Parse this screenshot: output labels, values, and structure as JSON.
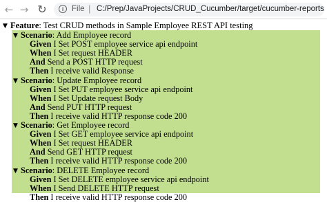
{
  "toolbar": {
    "back_glyph": "←",
    "forward_glyph": "→",
    "reload_glyph": "↻",
    "info_glyph": "i",
    "scheme_label": "File",
    "separator": "|",
    "url": "C:/Prep/JavaProjects/CRUD_Cucumber/target/cucumber-reports/index.html"
  },
  "report": {
    "feature_toggle": "▼",
    "feature_keyword": "Feature",
    "feature_name": ": Test CRUD methods in Sample Employee REST API testing",
    "background_color": "#c2de8f",
    "scenarios": [
      {
        "toggle": "▼",
        "keyword": "Scenario",
        "name": ": Add Employee record",
        "steps": [
          {
            "keyword": "Given",
            "text": " I Set POST employee service api endpoint"
          },
          {
            "keyword": "When",
            "text": " I Set request HEADER"
          },
          {
            "keyword": "And",
            "text": " Send a POST HTTP request"
          },
          {
            "keyword": "Then",
            "text": " I receive valid Response"
          }
        ]
      },
      {
        "toggle": "▼",
        "keyword": "Scenario",
        "name": ": Update Employee record",
        "steps": [
          {
            "keyword": "Given",
            "text": " I Set PUT employee service api endpoint"
          },
          {
            "keyword": "When",
            "text": " I Set Update request Body"
          },
          {
            "keyword": "And",
            "text": " Send PUT HTTP request"
          },
          {
            "keyword": "Then",
            "text": " I receive valid HTTP response code 200"
          }
        ]
      },
      {
        "toggle": "▼",
        "keyword": "Scenario",
        "name": ": Get Employee record",
        "steps": [
          {
            "keyword": "Given",
            "text": " I Set GET employee service api endpoint"
          },
          {
            "keyword": "When",
            "text": " I Set request HEADER"
          },
          {
            "keyword": "And",
            "text": " Send GET HTTP request"
          },
          {
            "keyword": "Then",
            "text": " I receive valid HTTP response code 200"
          }
        ]
      },
      {
        "toggle": "▼",
        "keyword": "Scenario",
        "name": ": DELETE Employee record",
        "steps": [
          {
            "keyword": "Given",
            "text": " I Set DELETE employee service api endpoint"
          },
          {
            "keyword": "When",
            "text": " I Send DELETE HTTP request"
          },
          {
            "keyword": "Then",
            "text": " I receive valid HTTP response code 200"
          }
        ]
      }
    ]
  }
}
